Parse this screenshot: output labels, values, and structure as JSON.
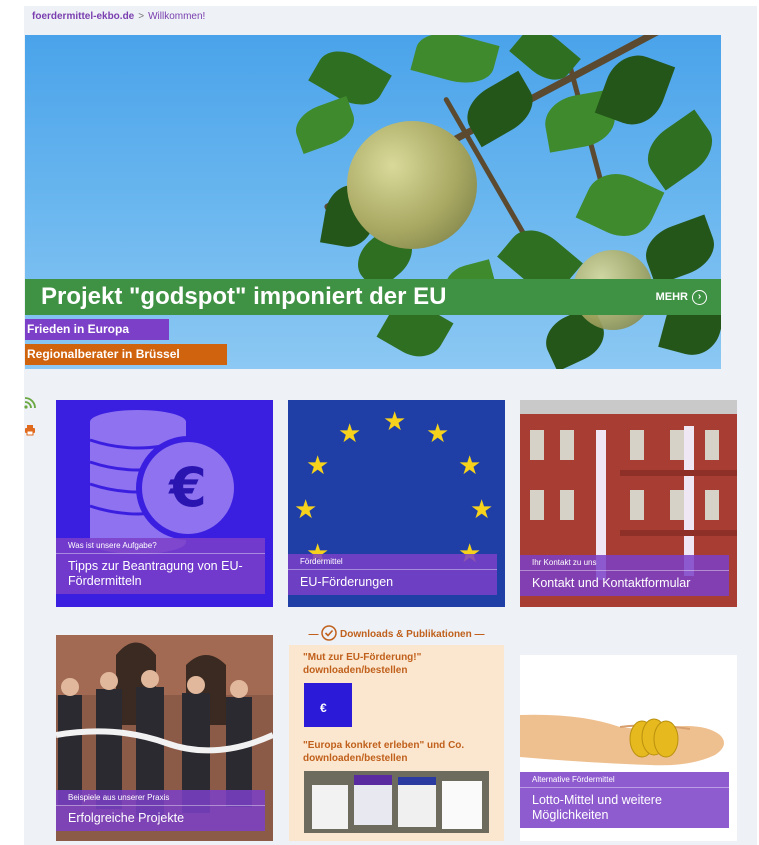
{
  "breadcrumb": {
    "site": "foerdermittel-ekbo.de",
    "separator": ">",
    "current": "Willkommen!"
  },
  "hero": {
    "title": "Projekt \"godspot\" imponiert der EU",
    "more_label": "MEHR",
    "tags": [
      "Frieden in Europa",
      "Regionalberater in Brüssel"
    ]
  },
  "tiles": [
    {
      "kicker": "Was ist unsere Aufgabe?",
      "title": "Tipps zur Beantragung von EU-Fördermitteln"
    },
    {
      "kicker": "Fördermittel",
      "title": "EU-Förderungen"
    },
    {
      "kicker": "Ihr Kontakt zu uns",
      "title": "Kontakt und Kontaktformular"
    },
    {
      "kicker": "Beispiele aus unserer Praxis",
      "title": "Erfolgreiche Projekte"
    },
    {
      "kicker": "Alternative Fördermittel",
      "title": "Lotto-Mittel und weitere Möglichkeiten"
    }
  ],
  "downloads": {
    "heading": "Downloads & Publikationen",
    "item1": "\"Mut zur EU-Förderung!\" downloaden/bestellen",
    "item2": "\"Europa konkret erleben\" und Co. downloaden/bestellen"
  },
  "colors": {
    "green": "#3f9144",
    "purple": "#7b3fc8",
    "orange": "#d0630e",
    "eu_blue": "#1f3fa6"
  }
}
